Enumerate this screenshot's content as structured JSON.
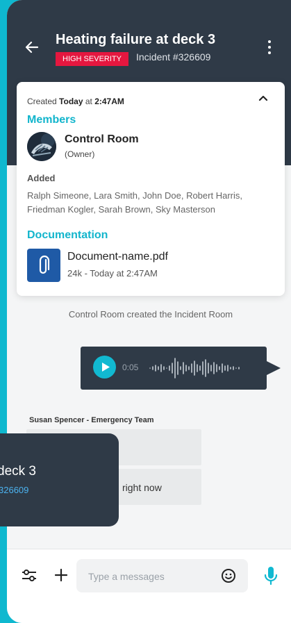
{
  "header": {
    "title": "Heating failure at deck 3",
    "severity": "HIGH SEVERITY",
    "incident_id": "Incident #326609"
  },
  "card": {
    "created_prefix": "Created",
    "created_day": "Today",
    "created_at": "at",
    "created_time": "2:47AM",
    "members_heading": "Members",
    "owner": {
      "name": "Control Room",
      "role": "(Owner)"
    },
    "added_label": "Added",
    "added_names": "Ralph Simeone, Lara Smith, John Doe, Robert Harris, Friedman Kogler, Sarah Brown, Sky Masterson",
    "documentation_heading": "Documentation",
    "document": {
      "name": "Document-name.pdf",
      "meta": "24k - Today at 2:47AM"
    }
  },
  "chat": {
    "system_message": "Control Room created the Incident Room",
    "voice_message": {
      "duration": "0:05"
    },
    "sender": "Susan Spencer - Emergency Team",
    "bubble2_text": "right now"
  },
  "composer": {
    "placeholder": "Type a messages"
  },
  "overlay": {
    "title": "deck 3",
    "subtitle": "326609"
  },
  "colors": {
    "accent": "#11b9d1",
    "header_bg": "#2f3a47",
    "severity": "#e5173f",
    "document_icon": "#1f5aa6",
    "overlay_link": "#4cb3f0"
  },
  "icons": [
    "back-arrow-icon",
    "more-vertical-icon",
    "chevron-up-icon",
    "paperclip-icon",
    "play-icon",
    "waveform-icon",
    "filter-icon",
    "plus-icon",
    "emoji-icon",
    "microphone-icon"
  ]
}
